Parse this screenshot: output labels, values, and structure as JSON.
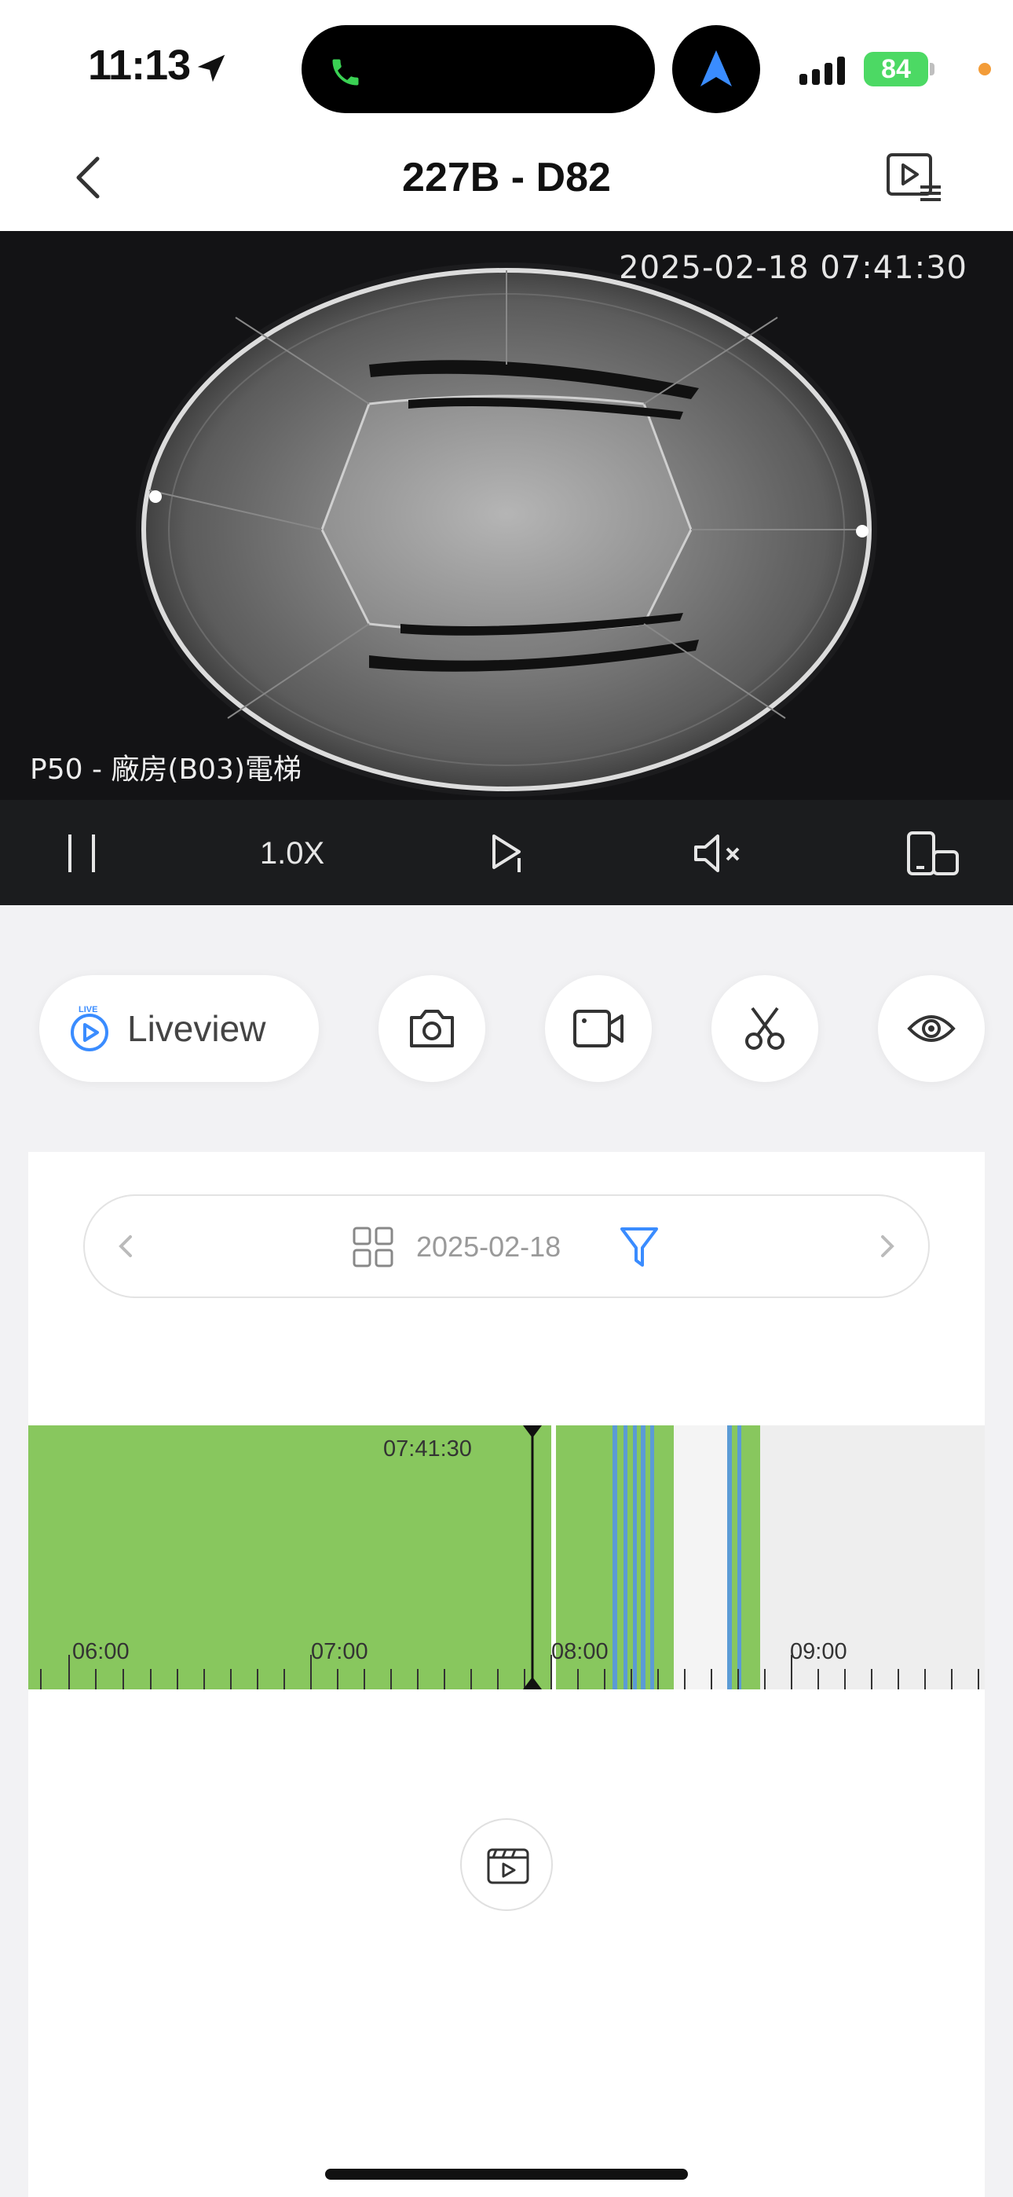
{
  "status_bar": {
    "time": "11:13",
    "battery": "84",
    "icons": [
      "location-arrow-icon",
      "phone-icon",
      "navigation-icon",
      "signal-icon",
      "battery-icon"
    ]
  },
  "header": {
    "title": "227B - D82",
    "back_icon": "chevron-left-icon",
    "playlist_icon": "video-playlist-icon"
  },
  "video": {
    "timestamp": "2025-02-18 07:41:30",
    "camera_name": "P50 - 廠房(B03)電梯"
  },
  "controls": {
    "speed": "1.0X",
    "icons": [
      "pause-icon",
      "play-step-icon",
      "mute-icon",
      "rotate-device-icon"
    ]
  },
  "actions": {
    "liveview_label": "Liveview",
    "live_badge": "LIVE",
    "icons": [
      "camera-icon",
      "record-icon",
      "scissors-icon",
      "eye-icon"
    ]
  },
  "date_bar": {
    "date": "2025-02-18",
    "icons": [
      "chevron-left-icon",
      "grid-icon",
      "filter-icon",
      "chevron-right-icon"
    ]
  },
  "timeline": {
    "cursor_time": "07:41:30",
    "hour_labels": [
      "06:00",
      "07:00",
      "08:00",
      "09:00"
    ],
    "colors": {
      "recording": "#88c75e",
      "event": "#5b9bd5",
      "empty": "#eeeeee"
    }
  },
  "bottom": {
    "clip_icon": "clapperboard-play-icon"
  }
}
